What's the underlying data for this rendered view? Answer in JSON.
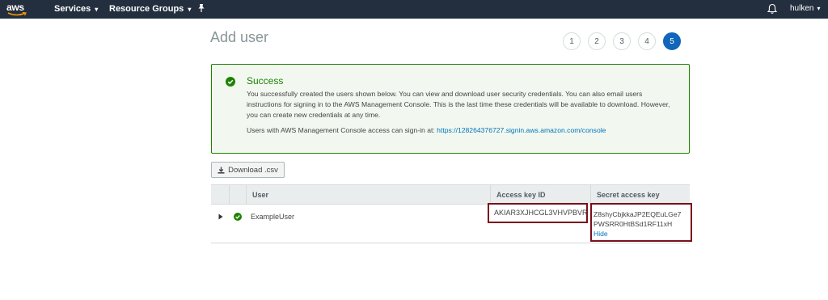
{
  "topbar": {
    "logo_text": "aws",
    "services_label": "Services",
    "resource_groups_label": "Resource Groups",
    "user_label": "hulken"
  },
  "page": {
    "title": "Add user",
    "steps": [
      "1",
      "2",
      "3",
      "4",
      "5"
    ],
    "active_step": "5"
  },
  "alert": {
    "title": "Success",
    "message": "You successfully created the users shown below. You can view and download user security credentials. You can also email users instructions for signing in to the AWS Management Console. This is the last time these credentials will be available to download. However, you can create new credentials at any time.",
    "signin_prefix": "Users with AWS Management Console access can sign-in at:",
    "signin_url": "https://128264376727.signin.aws.amazon.com/console"
  },
  "download_button": {
    "label": "Download .csv"
  },
  "table": {
    "headers": {
      "user": "User",
      "access_key": "Access key ID",
      "secret_key": "Secret access key"
    },
    "rows": [
      {
        "user": "ExampleUser",
        "access_key_id": "AKIAR3XJHCGL3VHVPBVR",
        "secret_line1": "Z8shyCbjkkaJP2EQEuLGe7",
        "secret_line2": "PWSRR0HtBSd1RF11xH",
        "hide_label": "Hide"
      }
    ]
  },
  "colors": {
    "topbar": "#232f3e",
    "success": "#1d8102",
    "link": "#0073bb",
    "active_step": "#1166bb",
    "highlight_box": "#7a0f1a"
  },
  "icons": [
    "aws-logo",
    "chevron-down-icon",
    "pin-icon",
    "bell-icon",
    "success-check-icon",
    "download-icon",
    "expand-triangle-icon"
  ]
}
